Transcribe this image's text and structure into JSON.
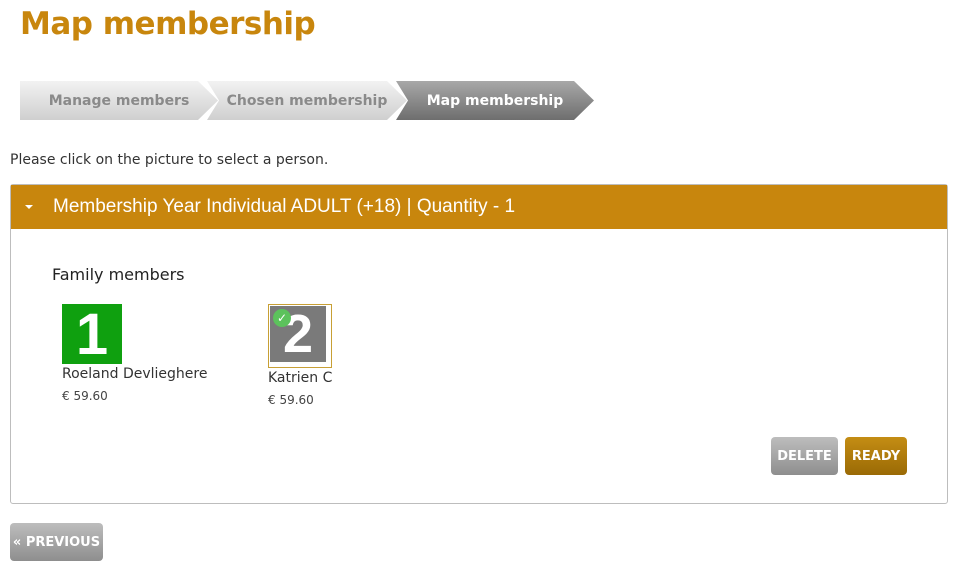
{
  "page": {
    "title": "Map membership",
    "instruction": "Please click on the picture to select a person."
  },
  "wizard": {
    "steps": [
      {
        "label": "Manage members",
        "state": "inactive"
      },
      {
        "label": "Chosen membership",
        "state": "inactive"
      },
      {
        "label": "Map membership",
        "state": "active"
      }
    ]
  },
  "panel": {
    "header": "Membership Year Individual ADULT (+18) | Quantity - 1",
    "section_title": "Family members",
    "members": [
      {
        "avatar_number": "1",
        "avatar_color": "#0fa00f",
        "name": "Roeland Devlieghere",
        "price": "€ 59.60",
        "selected": false
      },
      {
        "avatar_number": "2",
        "avatar_color": "#7a7a7a",
        "name": "Katrien C",
        "price": "€ 59.60",
        "selected": true
      }
    ],
    "delete_label": "DELETE",
    "ready_label": "READY"
  },
  "footer": {
    "previous_label": "« PREVIOUS"
  },
  "colors": {
    "accent": "#c8860d",
    "check": "#5cc25c"
  }
}
